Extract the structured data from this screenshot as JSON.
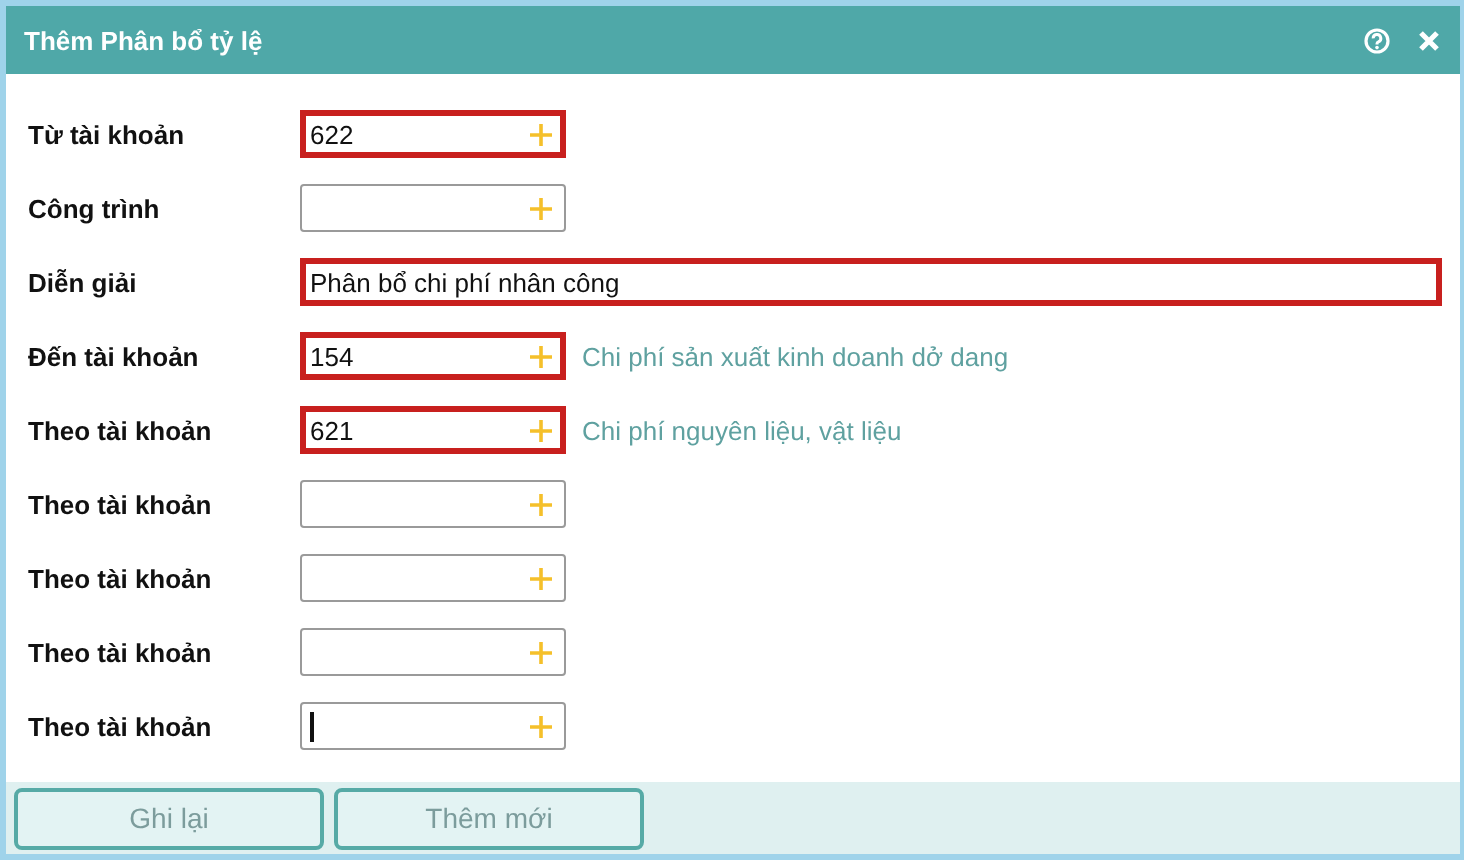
{
  "window": {
    "title": "Thêm Phân bổ tỷ lệ"
  },
  "rows": [
    {
      "kind": "account",
      "label": "Từ tài khoản",
      "value": "622",
      "highlighted": true,
      "focused": false
    },
    {
      "kind": "account",
      "label": "Công trình",
      "highlighted": false,
      "focused": false
    },
    {
      "kind": "text",
      "label": "Diễn giải",
      "value": "Phân bổ chi phí nhân công",
      "highlighted": true,
      "focused": false
    },
    {
      "kind": "account",
      "label": "Đến tài khoản",
      "value": "154",
      "hint": "Chi phí sản xuất kinh doanh dở dang",
      "highlighted": true,
      "focused": false
    },
    {
      "kind": "account",
      "label": "Theo tài khoản",
      "value": "621",
      "hint": "Chi phí nguyên liệu, vật liệu",
      "highlighted": true,
      "focused": false
    },
    {
      "kind": "account",
      "label": "Theo tài khoản",
      "highlighted": false,
      "focused": false
    },
    {
      "kind": "account",
      "label": "Theo tài khoản",
      "highlighted": false,
      "focused": false
    },
    {
      "kind": "account",
      "label": "Theo tài khoản",
      "highlighted": false,
      "focused": false
    },
    {
      "kind": "account",
      "label": "Theo tài khoản",
      "highlighted": false,
      "focused": true
    }
  ],
  "buttons": [
    "Ghi lại",
    "Thêm mới"
  ]
}
